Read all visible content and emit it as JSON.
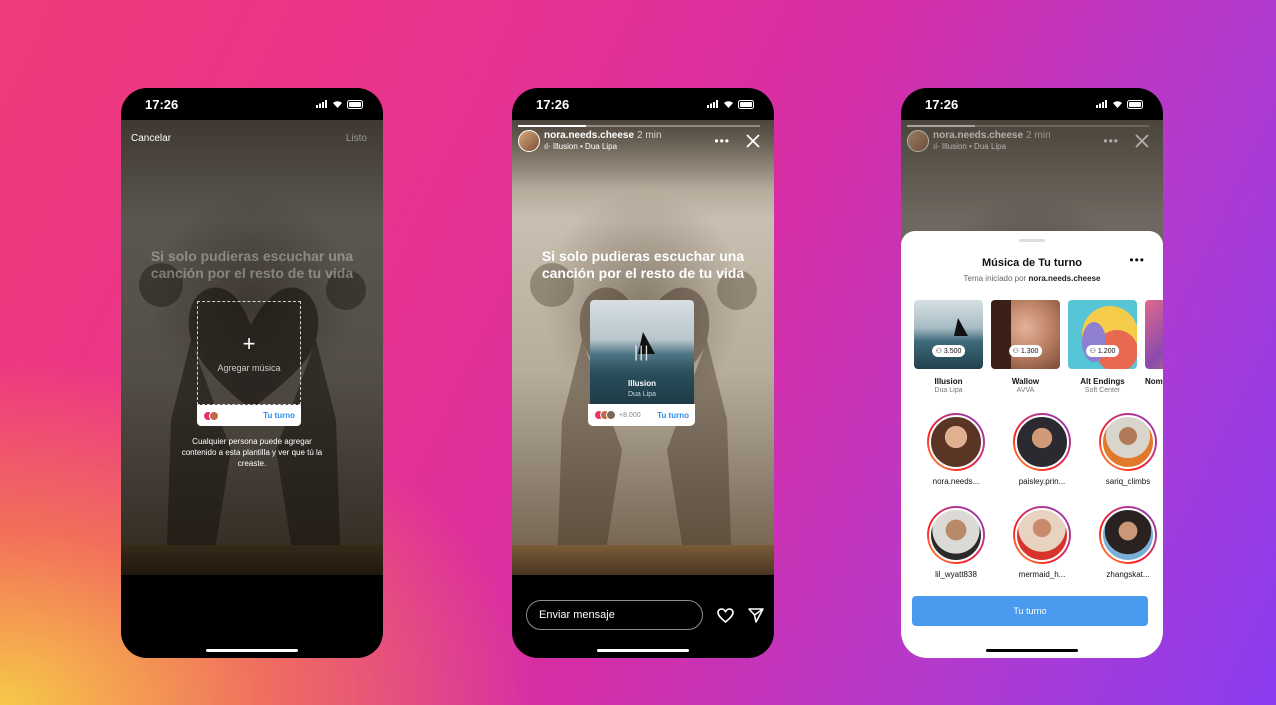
{
  "status": {
    "time": "17:26"
  },
  "phone1": {
    "cancel_label": "Cancelar",
    "done_label": "Listo",
    "prompt_text": "Si solo pudieras escuchar una canción por el resto de tu vida",
    "add_music_label": "Agregar música",
    "turn_label": "Tu turno",
    "helper_text": "Cualquier persona puede agregar contenido a esta plantilla y ver que tú la creaste."
  },
  "phone2": {
    "username": "nora.needs.cheese",
    "time_ago": "2 min",
    "song_line": "Illusion • Dua Lipa",
    "prompt_text": "Si solo pudieras escuchar una canción por el resto de tu vida",
    "card_title": "Illusion",
    "card_artist": "Dua Lipa",
    "participant_count": "+8.000",
    "turn_label": "Tu turno",
    "message_placeholder": "Enviar mensaje"
  },
  "phone3": {
    "username": "nora.needs.cheese",
    "time_ago": "2 min",
    "song_line": "Illusion • Dua Lipa",
    "sheet_title": "Música de Tu turno",
    "sheet_subtitle_prefix": "Tema iniciado por",
    "sheet_subtitle_user": "nora.needs.cheese",
    "tracks": [
      {
        "title": "Illusion",
        "artist": "Dua Lipa",
        "count": "3.500"
      },
      {
        "title": "Wallow",
        "artist": "AVVA",
        "count": "1.300"
      },
      {
        "title": "Alt Endings",
        "artist": "Soft Center",
        "count": "1.200"
      },
      {
        "title": "Nombre",
        "artist": "",
        "count": ""
      }
    ],
    "people": [
      "nora.needs...",
      "paisley.prin...",
      "sariq_climbs",
      "lil_wyatt838",
      "mermaid_h...",
      "zhangskat..."
    ],
    "cta_label": "Tu turno"
  },
  "colors": {
    "accent": "#4a9bf0",
    "link": "#2b8ef0"
  }
}
